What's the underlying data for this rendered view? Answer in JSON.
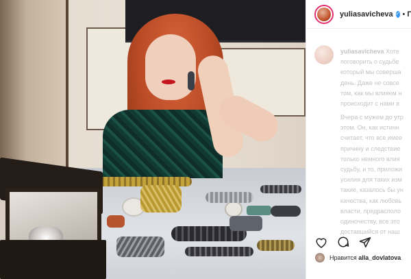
{
  "post": {
    "username": "yuliasavicheva",
    "separator": "•",
    "follow_label": "По"
  },
  "caption": {
    "username": "yuliasavicheva",
    "lines_first": [
      "Хоте",
      "поговорить о судьбе",
      "который мы соверша",
      "день. Даже не совсе",
      "том, как мы влияем н",
      "происходит с нами в"
    ],
    "lines_second": [
      "Вчера с мужем до утр",
      "этом. Он, как истинн",
      "считает, что все имее",
      "причину и следствие",
      "только немного влия",
      "судьбу, и то, приложи",
      "усилия для таких изм",
      "такие, казалось бы ун",
      "качества, как любовь",
      "власти, предрасполо",
      "одиночеству, все это",
      "доставшийся от наш"
    ]
  },
  "likes": {
    "prefix": "Нравится",
    "user": "alla_dovlatova"
  },
  "icons": {
    "like": "heart-icon",
    "comment": "comment-icon",
    "share": "share-icon",
    "verified": "verified-badge-icon"
  },
  "colors": {
    "story_ring": "#e1306c",
    "verified": "#3897f0"
  }
}
